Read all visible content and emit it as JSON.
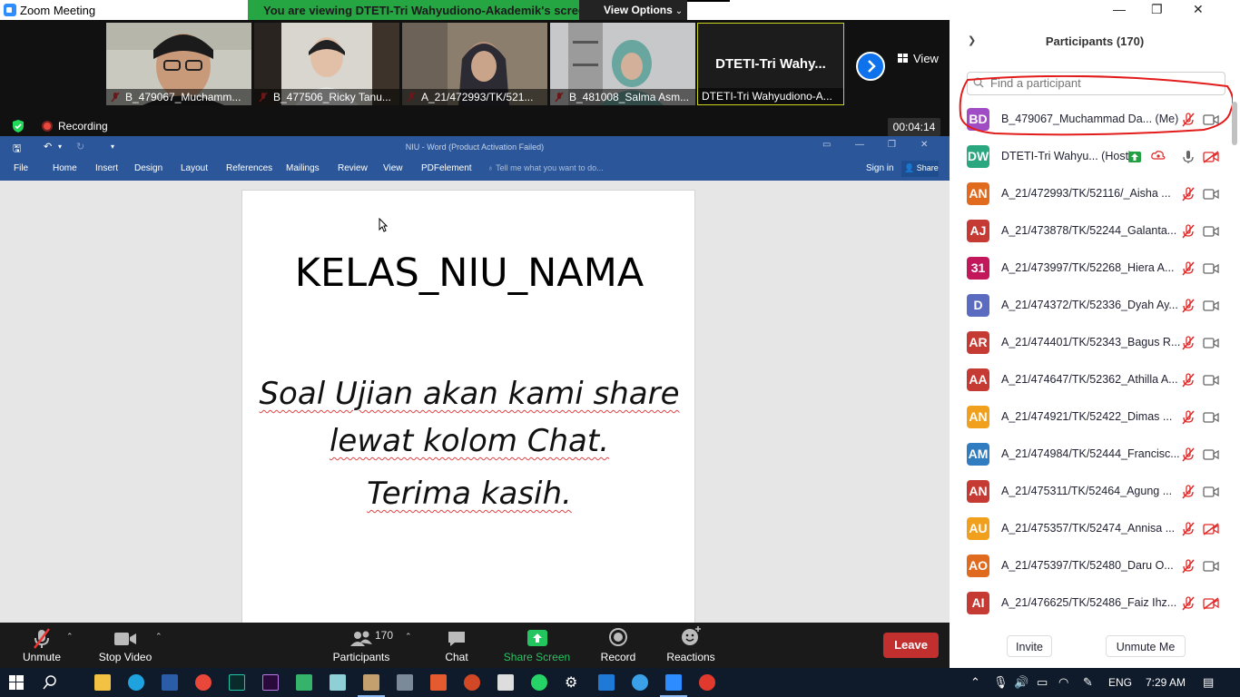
{
  "app": {
    "title": "Zoom Meeting",
    "viewing_banner": "You are viewing DTETI-Tri Wahyudiono-Akademik's screen",
    "view_options": "View Options"
  },
  "thumbnails": [
    {
      "name": "B_479067_Muchamm..."
    },
    {
      "name": "B_477506_Ricky Tanu..."
    },
    {
      "name": "A_21/472993/TK/521..."
    },
    {
      "name": "B_481008_Salma Asm..."
    },
    {
      "name": "DTETI-Tri Wahyudiono-A...",
      "display": "DTETI-Tri  Wahy..."
    }
  ],
  "view_button": "View",
  "recording": {
    "label": "Recording",
    "timer": "00:04:14"
  },
  "word": {
    "title": "NIU - Word (Product Activation Failed)",
    "tabs": [
      "File",
      "Home",
      "Insert",
      "Design",
      "Layout",
      "References",
      "Mailings",
      "Review",
      "View",
      "PDFelement"
    ],
    "tell_me": "Tell me what you want to do...",
    "sign_in": "Sign in",
    "share": "Share",
    "doc_title": "KELAS_NIU_NAMA",
    "doc_line1": "Soal Ujian akan kami share",
    "doc_line2": "lewat kolom Chat.",
    "doc_line3": "Terima kasih."
  },
  "toolbar": {
    "unmute": "Unmute",
    "stop_video": "Stop Video",
    "participants": "Participants",
    "participants_count": "170",
    "chat": "Chat",
    "share_screen": "Share Screen",
    "record": "Record",
    "reactions": "Reactions",
    "leave": "Leave"
  },
  "panel": {
    "title": "Participants (170)",
    "search_placeholder": "Find a participant",
    "participants": [
      {
        "initials": "BD",
        "color": "#a04cc4",
        "name": "B_479067_Muchammad Da... (Me)",
        "video_off": false,
        "mic": "muted"
      },
      {
        "initials": "DW",
        "color": "#2aa77f",
        "name": "DTETI-Tri Wahyu...  (Host)",
        "video_off": true,
        "mic": "on"
      },
      {
        "initials": "AN",
        "color": "#e06b1f",
        "name": "A_21/472993/TK/52116/_Aisha ...",
        "video_off": false,
        "mic": "muted"
      },
      {
        "initials": "AJ",
        "color": "#c63a34",
        "name": "A_21/473878/TK/52244_Galanta...",
        "video_off": false,
        "mic": "muted"
      },
      {
        "initials": "31",
        "color": "#c2185b",
        "name": "A_21/473997/TK/52268_Hiera A...",
        "video_off": false,
        "mic": "muted"
      },
      {
        "initials": "D",
        "color": "#5b6bc0",
        "name": "A_21/474372/TK/52336_Dyah Ay...",
        "video_off": false,
        "mic": "muted"
      },
      {
        "initials": "AR",
        "color": "#c63a34",
        "name": "A_21/474401/TK/52343_Bagus R...",
        "video_off": false,
        "mic": "muted"
      },
      {
        "initials": "AA",
        "color": "#c63a34",
        "name": "A_21/474647/TK/52362_Athilla A...",
        "video_off": false,
        "mic": "muted"
      },
      {
        "initials": "AN",
        "color": "#f0a01c",
        "name": "A_21/474921/TK/52422_Dimas ...",
        "video_off": false,
        "mic": "muted"
      },
      {
        "initials": "AM",
        "color": "#2f7cc0",
        "name": "A_21/474984/TK/52444_Francisc...",
        "video_off": false,
        "mic": "muted"
      },
      {
        "initials": "AN",
        "color": "#c63a34",
        "name": "A_21/475311/TK/52464_Agung ...",
        "video_off": false,
        "mic": "muted"
      },
      {
        "initials": "AU",
        "color": "#f0a01c",
        "name": "A_21/475357/TK/52474_Annisa ...",
        "video_off": true,
        "mic": "muted"
      },
      {
        "initials": "AO",
        "color": "#e06b1f",
        "name": "A_21/475397/TK/52480_Daru O...",
        "video_off": false,
        "mic": "muted"
      },
      {
        "initials": "AI",
        "color": "#c63a34",
        "name": "A_21/476625/TK/52486_Faiz Ihz...",
        "video_off": true,
        "mic": "muted"
      }
    ],
    "invite": "Invite",
    "unmute_me": "Unmute Me"
  },
  "taskbar": {
    "language": "ENG",
    "time": "7:29 AM"
  }
}
